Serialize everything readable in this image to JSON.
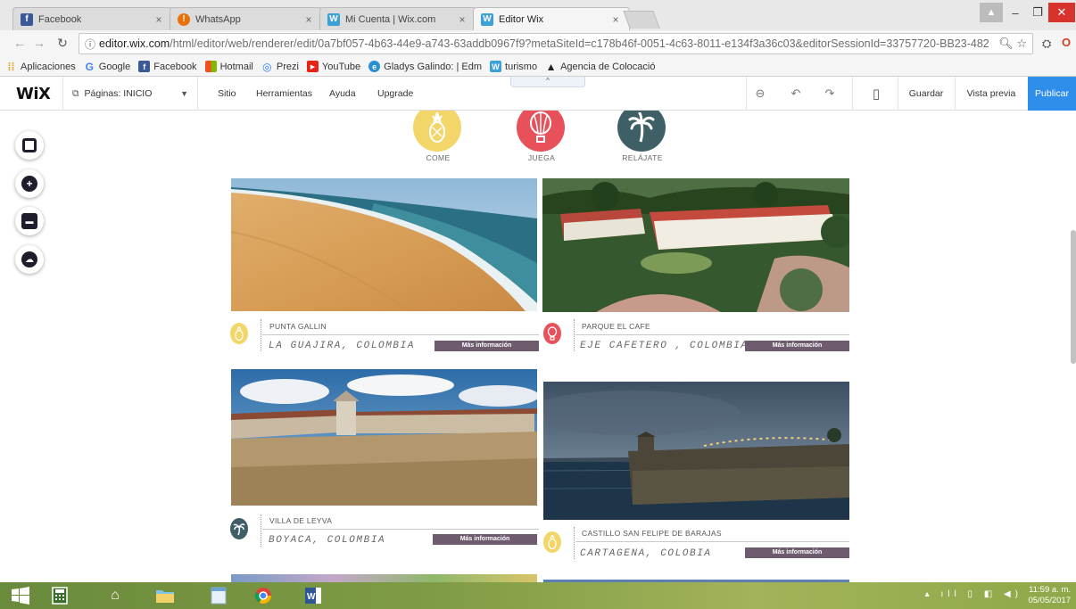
{
  "browser": {
    "tabs": [
      {
        "label": "Facebook",
        "icon": "facebook-icon",
        "color": "#3b5998",
        "glyph": "f"
      },
      {
        "label": "WhatsApp",
        "icon": "whatsapp-alert-icon",
        "color": "#e8710a",
        "glyph": "!"
      },
      {
        "label": "Mi Cuenta | Wix.com",
        "icon": "wix-icon",
        "color": "#3ba1d9",
        "glyph": "W"
      },
      {
        "label": "Editor Wix",
        "icon": "wix-icon",
        "color": "#3ba1d9",
        "glyph": "W"
      }
    ],
    "close_glyph": "×",
    "url_host": "editor.wix.com",
    "url_path": "/html/editor/web/renderer/edit/0a7bf057-4b63-44e9-a743-63addb0967f9?metaSiteId=c178b46f-0051-4c63-8011-e134f3a36c03&editorSessionId=33757720-BB23-482",
    "bookmarks": [
      {
        "label": "Aplicaciones",
        "icon": "apps-grid-icon",
        "color": "#e0a020",
        "glyph": "⋮"
      },
      {
        "label": "Google",
        "icon": "google-icon",
        "color": "#4285f4",
        "glyph": "G"
      },
      {
        "label": "Facebook",
        "icon": "facebook-icon",
        "color": "#3b5998",
        "glyph": "f"
      },
      {
        "label": "Hotmail",
        "icon": "windows-icon",
        "color": "#f25022",
        "glyph": "■"
      },
      {
        "label": "Prezi",
        "icon": "prezi-icon",
        "color": "#3181ff",
        "glyph": "◎"
      },
      {
        "label": "YouTube",
        "icon": "youtube-icon",
        "color": "#e62117",
        "glyph": "▶"
      },
      {
        "label": "Gladys Galindo: | Edm",
        "icon": "edmodo-icon",
        "color": "#2b8fd6",
        "glyph": "e"
      },
      {
        "label": "turismo",
        "icon": "wix-icon",
        "color": "#3ba1d9",
        "glyph": "W"
      },
      {
        "label": "Agencia de Colocació",
        "icon": "agency-logo-icon",
        "color": "#222222",
        "glyph": "▲"
      }
    ]
  },
  "wix": {
    "logo": "WiX",
    "pages_label": "Páginas: INICIO",
    "menu": [
      "Sitio",
      "Herramientas",
      "Ayuda",
      "Upgrade"
    ],
    "save": "Guardar",
    "preview": "Vista previa",
    "publish": "Publicar"
  },
  "categories": [
    {
      "label": "COME",
      "icon": "pineapple-icon",
      "color": "#f2d66a"
    },
    {
      "label": "JUEGA",
      "icon": "hot-air-balloon-icon",
      "color": "#e8515a"
    },
    {
      "label": "RELÁJATE",
      "icon": "palm-tree-icon",
      "color": "#3f5f66"
    }
  ],
  "cards": [
    {
      "place": "PUNTA GALLIN",
      "region": "LA GUAJIRA, COLOMBIA",
      "more": "Más información",
      "badge_icon": "pineapple-icon",
      "badge_color": "#f2d66a"
    },
    {
      "place": "PARQUE EL CAFE",
      "region": "EJE CAFETERO , COLOMBIA",
      "more": "Más información",
      "badge_icon": "hot-air-balloon-icon",
      "badge_color": "#e8515a"
    },
    {
      "place": "VILLA DE LEYVA",
      "region": "BOYACA, COLOMBIA",
      "more": "Más información",
      "badge_icon": "palm-tree-icon",
      "badge_color": "#3f5f66"
    },
    {
      "place": "CASTILLO SAN FELIPE DE BARAJAS",
      "region": "CARTAGENA, COLOBIA",
      "more": "Más información",
      "badge_icon": "pineapple-icon",
      "badge_color": "#f2d66a"
    }
  ],
  "taskbar": {
    "clock_time": "11:59 a. m.",
    "clock_date": "05/05/2017"
  }
}
